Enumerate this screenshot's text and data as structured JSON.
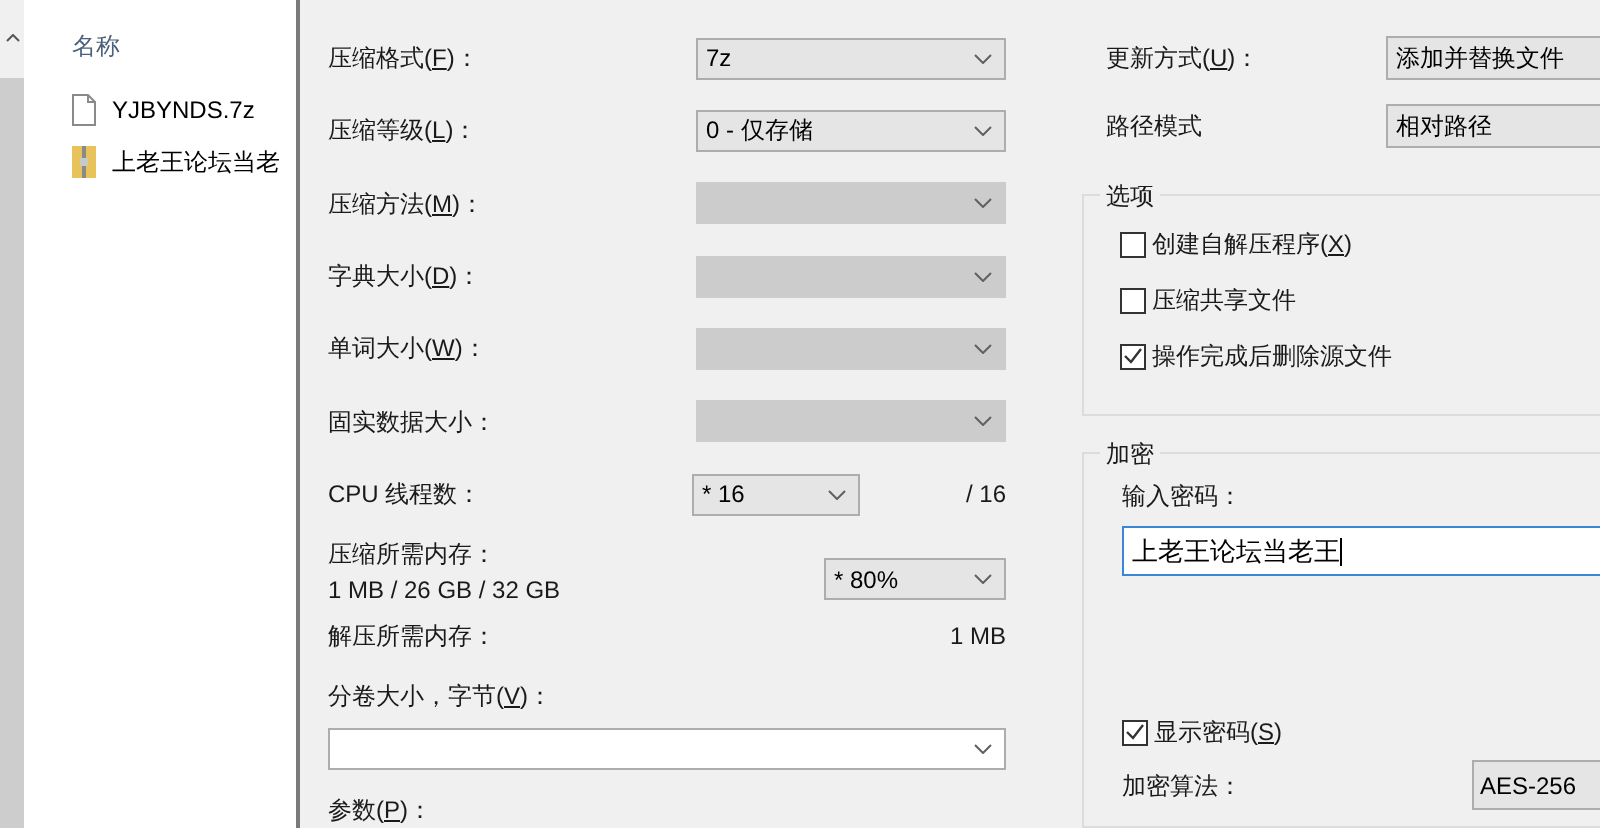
{
  "explorer": {
    "column_header": "名称",
    "files": [
      {
        "name": "YJBYNDS.7z",
        "kind": "file"
      },
      {
        "name": "上老王论坛当老",
        "kind": "archive"
      }
    ]
  },
  "left_rows": [
    {
      "label": {
        "before": "压缩格式(",
        "key": "F",
        "after": ")："
      },
      "value": "7z",
      "disabled": false
    },
    {
      "label": {
        "before": "压缩等级(",
        "key": "L",
        "after": ")："
      },
      "value": "0 - 仅存储",
      "disabled": false
    },
    {
      "label": {
        "before": "压缩方法(",
        "key": "M",
        "after": ")："
      },
      "disabled": true
    },
    {
      "label": {
        "before": "字典大小(",
        "key": "D",
        "after": ")："
      },
      "disabled": true
    },
    {
      "label": {
        "before": "单词大小(",
        "key": "W",
        "after": ")："
      },
      "disabled": true
    },
    {
      "label": {
        "before": "固实数据大小："
      },
      "disabled": true
    }
  ],
  "cpu": {
    "label": "CPU 线程数：",
    "value": "* 16",
    "max": "/ 16"
  },
  "memory": {
    "label": "压缩所需内存：",
    "detail": "1 MB / 26 GB / 32 GB",
    "value": "* 80%"
  },
  "decompress": {
    "label": "解压所需内存：",
    "value": "1 MB"
  },
  "split": {
    "label": {
      "before": "分卷大小，字节(",
      "key": "V",
      "after": ")："
    }
  },
  "params": {
    "label": {
      "before": "参数(",
      "key": "P",
      "after": ")："
    }
  },
  "right_rows": [
    {
      "label": {
        "before": "更新方式(",
        "key": "U",
        "after": ")："
      },
      "value": "添加并替换文件"
    },
    {
      "label": {
        "before": "路径模式"
      },
      "value": "相对路径"
    }
  ],
  "options": {
    "title": "选项",
    "items": [
      {
        "label": {
          "before": "创建自解压程序(",
          "key": "X",
          "after": ")"
        },
        "checked": false
      },
      {
        "label": {
          "before": "压缩共享文件"
        },
        "checked": false
      },
      {
        "label": {
          "before": "操作完成后删除源文件"
        },
        "checked": true
      }
    ]
  },
  "encryption": {
    "title": "加密",
    "password_label": "输入密码：",
    "password": "上老王论坛当老王",
    "show_password": {
      "label": {
        "before": "显示密码(",
        "key": "S",
        "after": ")"
      },
      "checked": true
    },
    "method_label": "加密算法：",
    "method": "AES-256"
  }
}
